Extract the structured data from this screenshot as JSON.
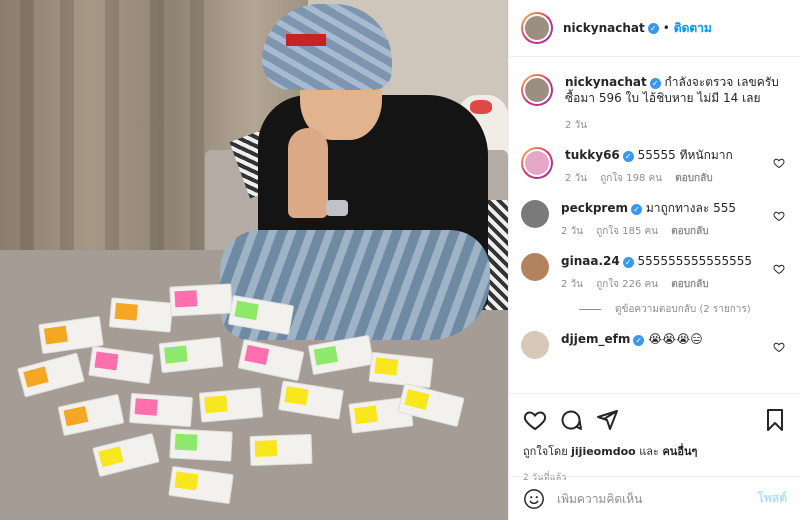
{
  "post": {
    "username": "nickynachat",
    "follow_label": "ติดตาม",
    "caption": "กำลังจะตรวจ เลขครับ ซื้อมา 596 ใบ ไอ้ชิบหาย ไม่มี 14 เลย",
    "caption_time": "2 วัน"
  },
  "comments": [
    {
      "username": "tukky66",
      "text": "55555 ทีหนักมาก",
      "time": "2 วัน",
      "likes": "ถูกใจ 198 คน",
      "reply": "ตอบกลับ"
    },
    {
      "username": "peckprem",
      "text": "มาถูกทางละ 555",
      "time": "2 วัน",
      "likes": "ถูกใจ 185 คน",
      "reply": "ตอบกลับ"
    },
    {
      "username": "ginaa.24",
      "text": "555555555555555",
      "time": "2 วัน",
      "likes": "ถูกใจ 226 คน",
      "reply": "ตอบกลับ"
    },
    {
      "username": "djjem_efm",
      "text": "😭😭😭😑"
    }
  ],
  "view_replies": "ดูข้อความตอบกลับ (2 รายการ)",
  "likes_summary": {
    "prefix": "ถูกใจโดย",
    "user": "jijieomdoo",
    "joiner": "และ",
    "others": "คนอื่นๆ"
  },
  "post_time": "2 วันที่แล้ว",
  "composer": {
    "placeholder": "เพิ่มความคิดเห็น",
    "post_label": "โพสต์"
  },
  "colors": {
    "link_blue": "#0095f6",
    "verified_blue": "#3897f0",
    "muted": "#8e8e8e"
  }
}
